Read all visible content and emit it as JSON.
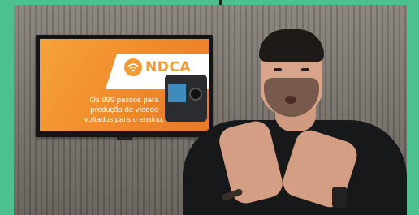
{
  "video": {
    "tv_slide": {
      "logo_text": "NDCA",
      "caption_lines": [
        "Os 999 passos para",
        "produção de vídeos",
        "voltados para o ensino."
      ]
    }
  },
  "colors": {
    "frame_accent": "#4cc08f",
    "slide_orange": "#f39a35",
    "shirt": "#17181a"
  },
  "icons": {
    "logo": "wifi-circle-icon"
  }
}
